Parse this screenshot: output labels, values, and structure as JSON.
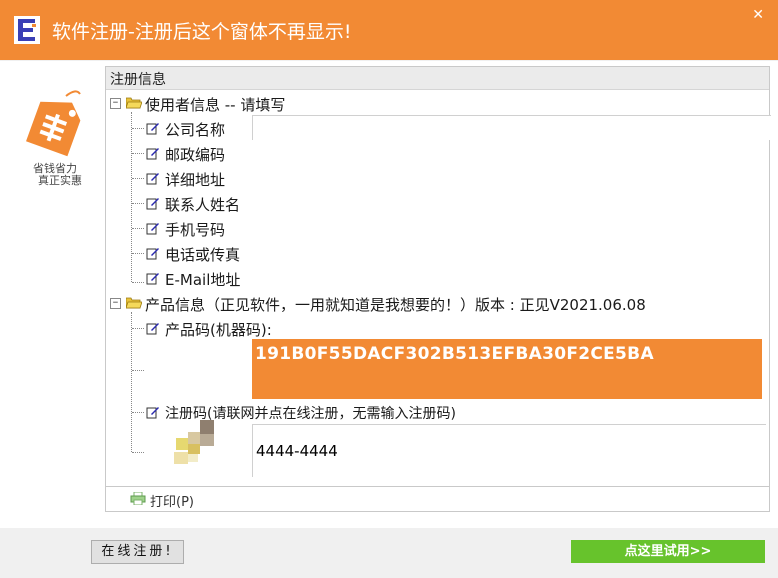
{
  "window": {
    "title": "软件注册-注册后这个窗体不再显示!",
    "close_icon": "close-icon"
  },
  "colors": {
    "accent": "#f28a34",
    "trial_button": "#67c32c"
  },
  "logo": {
    "caption_line1": "省钱省力",
    "caption_line2": "真正实惠"
  },
  "panel": {
    "header": "注册信息",
    "user_info": {
      "label": "使用者信息 -- 请填写",
      "expander": "−",
      "fields": [
        {
          "label": "公司名称",
          "value": ""
        },
        {
          "label": "邮政编码",
          "value": ""
        },
        {
          "label": "详细地址",
          "value": ""
        },
        {
          "label": "联系人姓名",
          "value": ""
        },
        {
          "label": "手机号码",
          "value": ""
        },
        {
          "label": "电话或传真",
          "value": ""
        },
        {
          "label": "E-Mail地址",
          "value": ""
        }
      ]
    },
    "product_info": {
      "label": "产品信息（正见软件，一用就知道是我想要的！）版本 : 正见V2021.06.08",
      "expander": "−",
      "product_code_label": "产品码(机器码):",
      "product_code": "191B0F55DACF302B513EFBA30F2CE5BA",
      "reg_code_label": "注册码(请联网并点在线注册，无需输入注册码)",
      "reg_code_value": "4444-4444"
    },
    "print_label": "打印(P)"
  },
  "buttons": {
    "online_register": "在线注册!",
    "trial": "点这里试用>>"
  }
}
